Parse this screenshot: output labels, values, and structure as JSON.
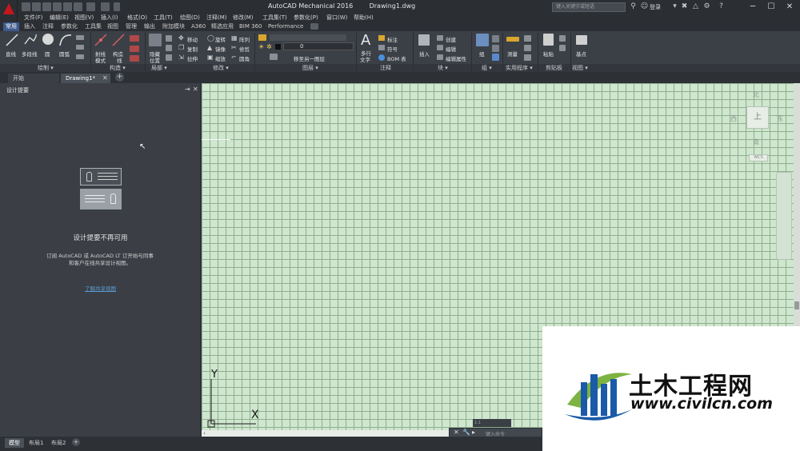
{
  "title_bar": {
    "app_title": "AutoCAD Mechanical 2016",
    "file_title": "Drawing1.dwg",
    "search_placeholder": "键入关键字或短语",
    "sign_in": "登录",
    "minimize": "─",
    "maximize": "☐",
    "close": "✕"
  },
  "menu": [
    "文件(F)",
    "编辑(E)",
    "视图(V)",
    "插入(I)",
    "格式(O)",
    "工具(T)",
    "绘图(D)",
    "注释(M)",
    "修改(M)",
    "工具集(T)",
    "参数化(P)",
    "窗口(W)",
    "帮助(H)"
  ],
  "ribbon_tabs": [
    "常用",
    "插入",
    "注释",
    "参数化",
    "工具集",
    "视图",
    "管理",
    "输出",
    "附加模块",
    "A360",
    "精选应用",
    "BIM 360",
    "Performance"
  ],
  "ribbon": {
    "draw": {
      "line": "直线",
      "polyline": "多段线",
      "circle": "圆",
      "arc": "圆弧",
      "panel": "绘制 ▾"
    },
    "construct": {
      "xline": "射线",
      "mode": "模式",
      "construction": "构造",
      "lines": "线",
      "panel": "构造 ▾"
    },
    "detail": {
      "hide": "隐藏",
      "position": "位置",
      "panel": "局部 ▾"
    },
    "modify": {
      "move": "移动",
      "rotate": "旋转",
      "array": "阵列",
      "copy": "复制",
      "mirror": "镜像",
      "trim": "修剪",
      "stretch": "拉伸",
      "scale": "缩放",
      "fillet": "圆角",
      "panel": "修改 ▾"
    },
    "layers": {
      "layer_value": "0",
      "move_to": "移至另一图层",
      "panel": "图层 ▾"
    },
    "annotation": {
      "mtext": "多行",
      "text": "文字",
      "dimension": "标注",
      "symbol": "符号",
      "bom": "BOM 表",
      "panel": "注释"
    },
    "block": {
      "insert": "插入",
      "create": "创建",
      "edit": "编辑",
      "edit_attr": "编辑属性",
      "panel": "块 ▾"
    },
    "group": {
      "group": "组",
      "panel": "组 ▾"
    },
    "utilities": {
      "measure": "测量",
      "panel": "实用程序 ▾"
    },
    "clipboard": {
      "paste": "粘贴",
      "panel": "剪贴板"
    },
    "view": {
      "base": "基点",
      "panel": "视图 ▾"
    }
  },
  "file_tabs": [
    "开始",
    "Drawing1*"
  ],
  "palette": {
    "title": "设计提要",
    "message": "设计提要不再可用",
    "detail": "订阅 AutoCAD 或 AutoCAD LT 订开始与同事和客户在线共享设计视图。",
    "link": "了解共享视图"
  },
  "viewcube": {
    "north": "北",
    "south": "南",
    "east": "东",
    "west": "西",
    "top": "上",
    "wcs": "WCS"
  },
  "ucs": {
    "x": "X",
    "y": "Y"
  },
  "command": {
    "placeholder": "键入命令",
    "coords": "1:1"
  },
  "layout_tabs": [
    "模型",
    "布局1",
    "布局2",
    "+"
  ],
  "watermark": {
    "brand": "土木工程网",
    "url": "www.civilcn.com"
  },
  "colors": {
    "accent": "#3d5a8c",
    "app_red": "#c4161c",
    "grid_bg": "#cfe6cf",
    "logo_blue": "#1a5aa8",
    "logo_green": "#7cb342"
  }
}
